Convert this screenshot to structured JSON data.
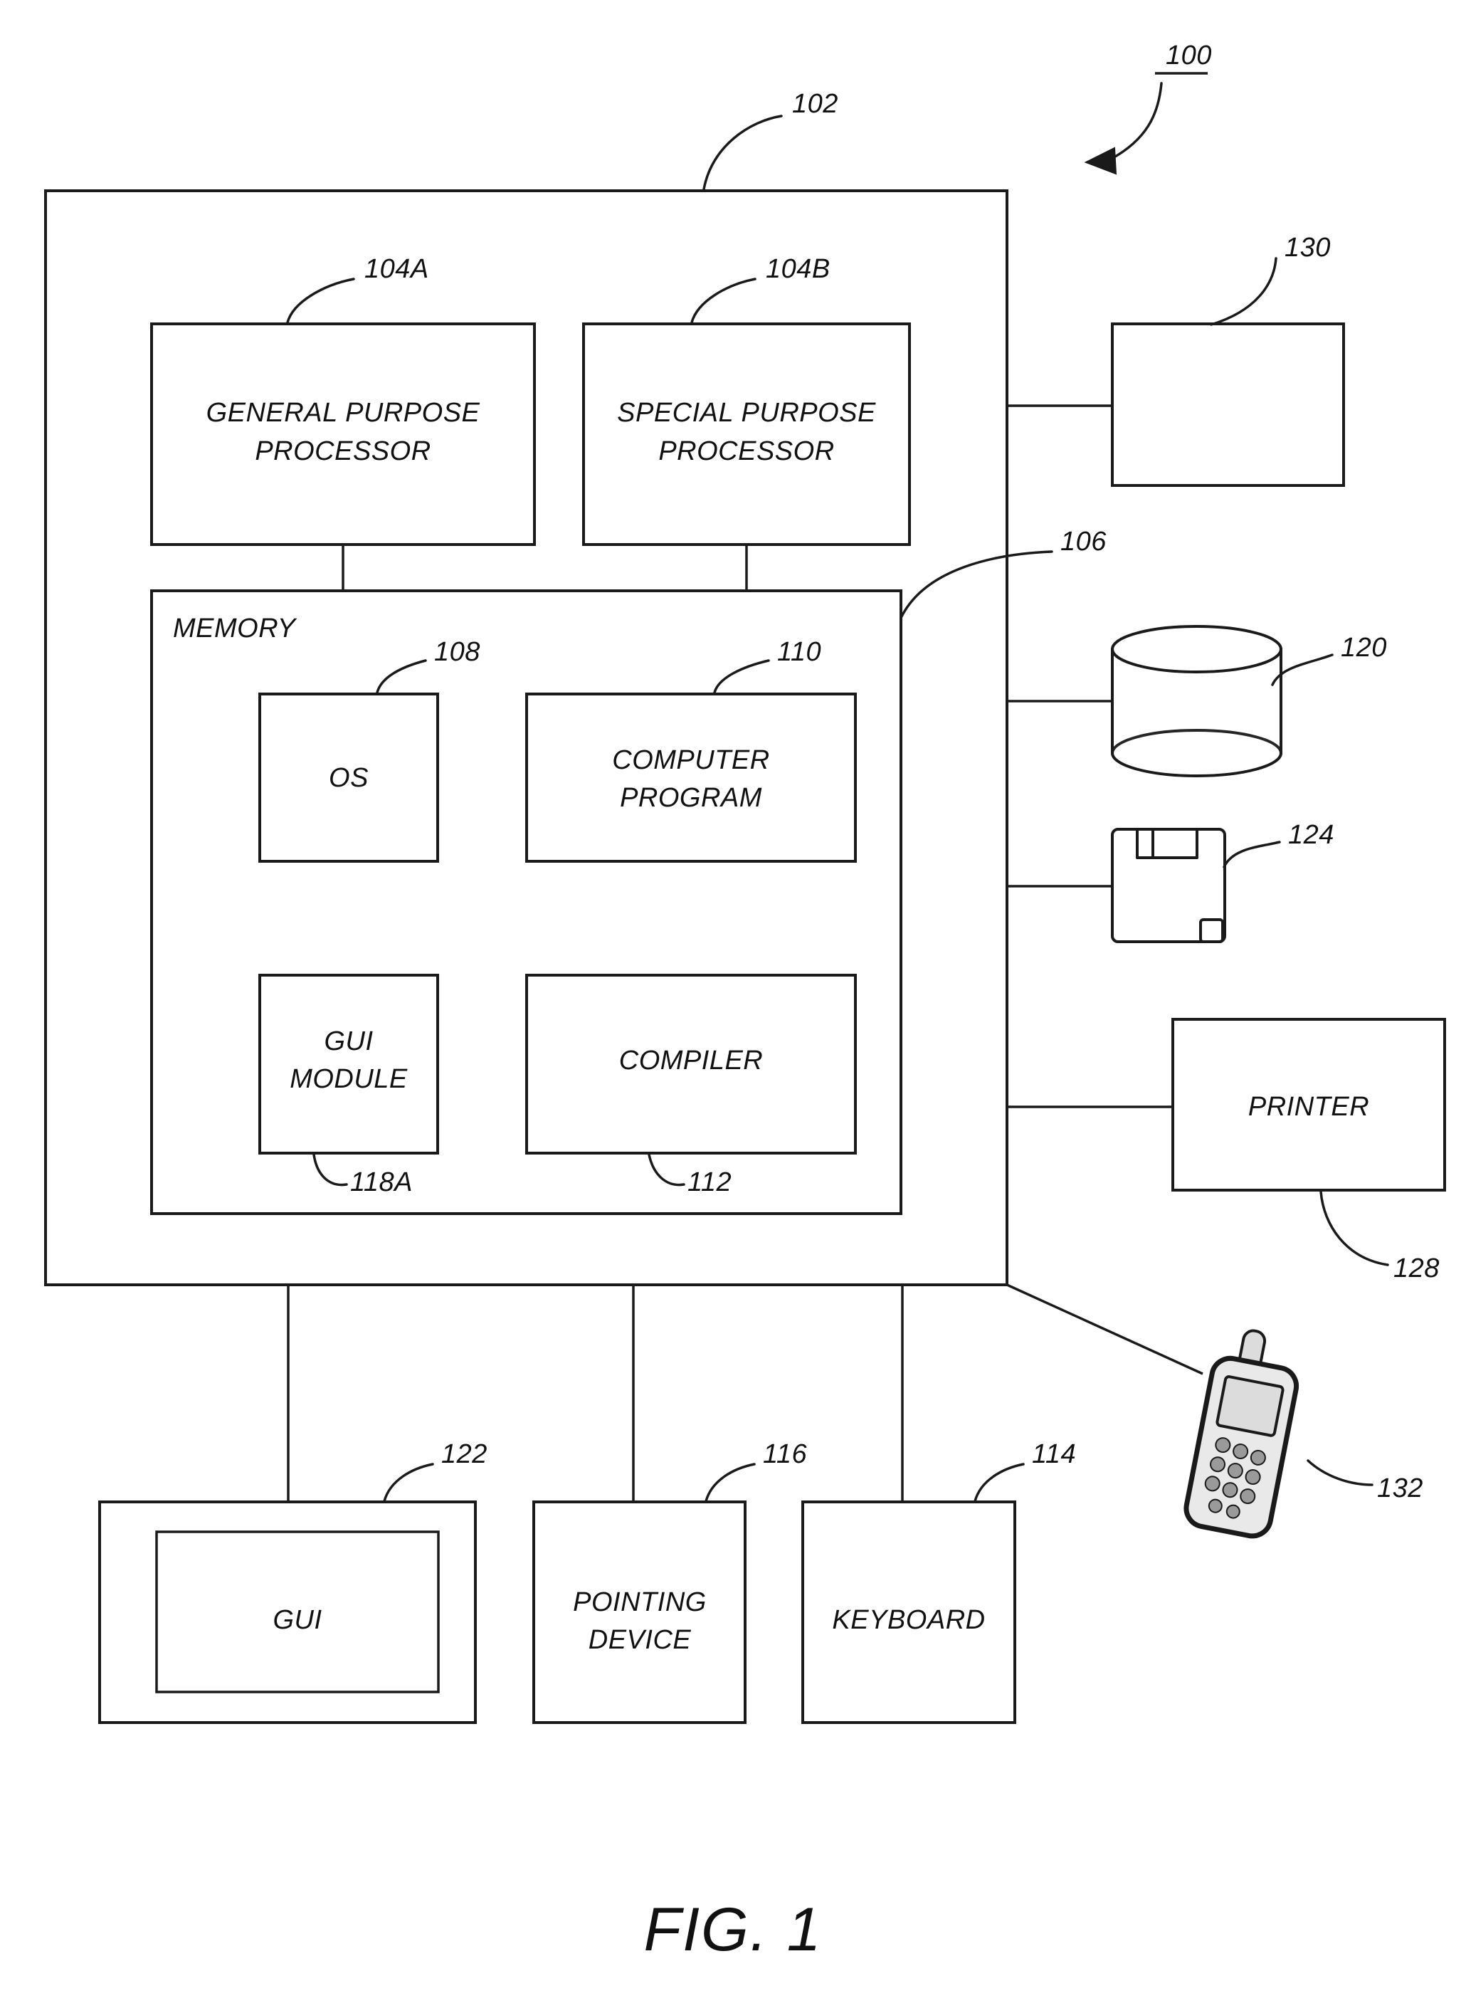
{
  "figure": {
    "caption": "FIG. 1",
    "overall_ref": "100"
  },
  "system": {
    "computer_ref": "102",
    "blocks": [
      {
        "id": "general-purpose-processor",
        "label_line1": "GENERAL PURPOSE",
        "label_line2": "PROCESSOR",
        "ref": "104A"
      },
      {
        "id": "special-purpose-processor",
        "label_line1": "SPECIAL PURPOSE",
        "label_line2": "PROCESSOR",
        "ref": "104B"
      },
      {
        "id": "memory",
        "label_line1": "MEMORY",
        "label_line2": "",
        "ref": "106"
      },
      {
        "id": "os",
        "label_line1": "OS",
        "label_line2": "",
        "ref": "108"
      },
      {
        "id": "computer-program",
        "label_line1": "COMPUTER",
        "label_line2": "PROGRAM",
        "ref": "110"
      },
      {
        "id": "gui-module",
        "label_line1": "GUI",
        "label_line2": "MODULE",
        "ref": "118A"
      },
      {
        "id": "compiler",
        "label_line1": "COMPILER",
        "label_line2": "",
        "ref": "112"
      }
    ]
  },
  "peripherals": [
    {
      "id": "unlabeled-device",
      "label": "",
      "ref": "130",
      "icon": "rectangle-icon"
    },
    {
      "id": "data-storage",
      "label": "",
      "ref": "120",
      "icon": "cylinder-database-icon"
    },
    {
      "id": "removable-media",
      "label": "",
      "ref": "124",
      "icon": "floppy-disk-icon"
    },
    {
      "id": "printer",
      "label": "PRINTER",
      "ref": "128",
      "icon": "printer-box-icon"
    },
    {
      "id": "mobile-device",
      "label": "",
      "ref": "132",
      "icon": "mobile-phone-icon"
    }
  ],
  "io_devices": [
    {
      "id": "gui-display",
      "label": "GUI",
      "ref": "122"
    },
    {
      "id": "pointing-device",
      "label_line1": "POINTING",
      "label_line2": "DEVICE",
      "ref": "116"
    },
    {
      "id": "keyboard",
      "label": "KEYBOARD",
      "ref": "114"
    }
  ],
  "colors": {
    "ink": "#1a1a1a",
    "background": "#ffffff",
    "phone_fill": "#e9e9e9"
  }
}
